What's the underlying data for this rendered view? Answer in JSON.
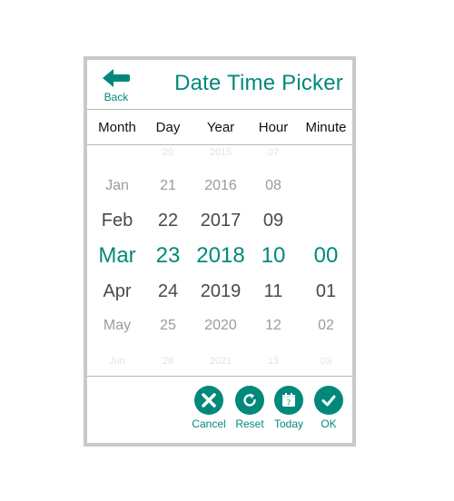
{
  "header": {
    "back_label": "Back",
    "title": "Date Time Picker"
  },
  "columns": {
    "month": "Month",
    "day": "Day",
    "year": "Year",
    "hour": "Hour",
    "minute": "Minute"
  },
  "wheels": {
    "month": [
      "",
      "Jan",
      "Feb",
      "Mar",
      "Apr",
      "May",
      "Jun"
    ],
    "day": [
      "20",
      "21",
      "22",
      "23",
      "24",
      "25",
      "26"
    ],
    "year": [
      "2015",
      "2016",
      "2017",
      "2018",
      "2019",
      "2020",
      "2021"
    ],
    "hour": [
      "07",
      "08",
      "09",
      "10",
      "11",
      "12",
      "13"
    ],
    "minute": [
      "",
      "",
      "",
      "00",
      "01",
      "02",
      "03"
    ]
  },
  "selected": {
    "month": "Mar",
    "day": "23",
    "year": "2018",
    "hour": "10",
    "minute": "00"
  },
  "footer": {
    "cancel": "Cancel",
    "reset": "Reset",
    "today": "Today",
    "today_icon_text": "7",
    "ok": "OK"
  },
  "colors": {
    "accent": "#00897b",
    "frame": "#c9c9c9"
  },
  "icons": {
    "back": "arrow-left-icon",
    "cancel": "close-icon",
    "reset": "refresh-icon",
    "today": "calendar-icon",
    "ok": "checkmark-icon"
  }
}
